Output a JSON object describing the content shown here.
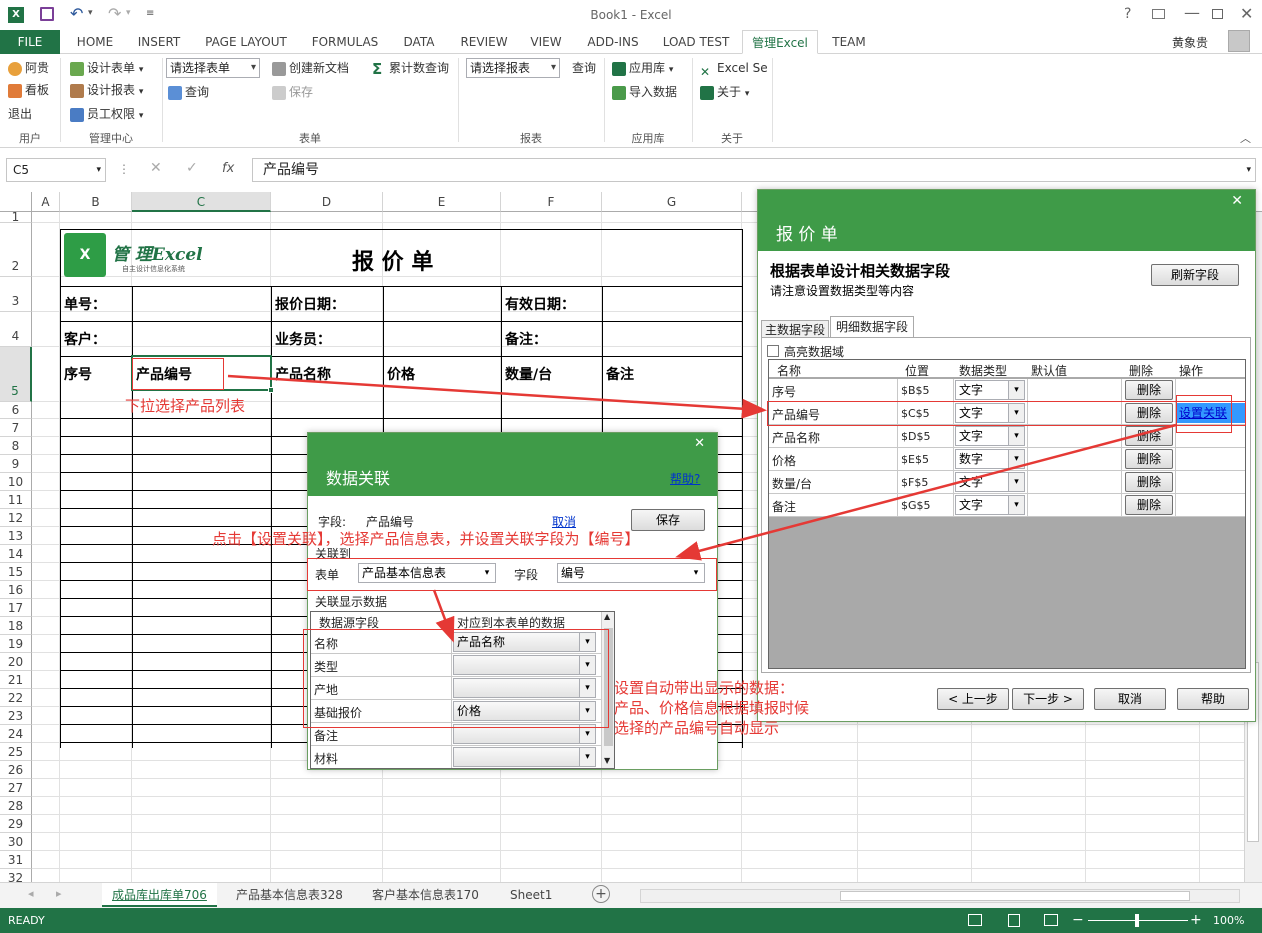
{
  "window": {
    "title": "Book1 - Excel",
    "user": "黄象贵"
  },
  "tabs": [
    "FILE",
    "HOME",
    "INSERT",
    "PAGE LAYOUT",
    "FORMULAS",
    "DATA",
    "REVIEW",
    "VIEW",
    "ADD-INS",
    "LOAD TEST",
    "管理Excel",
    "TEAM"
  ],
  "ribbon": {
    "user_group": {
      "label": "用户",
      "items": [
        "阿贵",
        "看板",
        "退出"
      ]
    },
    "mgmt_group": {
      "label": "管理中心",
      "items": [
        "设计表单",
        "设计报表",
        "员工权限"
      ]
    },
    "form_group": {
      "label": "表单",
      "select": "请选择表单",
      "query": "查询",
      "create": "创建新文档",
      "save": "保存"
    },
    "cum_query": "累计数查询",
    "report_group": {
      "label": "报表",
      "select": "请选择报表",
      "query": "查询"
    },
    "app_group": {
      "label": "应用库",
      "items": [
        "应用库",
        "导入数据"
      ]
    },
    "about_group": {
      "label": "关于",
      "items": [
        "Excel Se",
        "关于"
      ]
    }
  },
  "formula_bar": {
    "name_box": "C5",
    "fx": "fx",
    "formula": "产品编号"
  },
  "columns": [
    "A",
    "B",
    "C",
    "D",
    "E",
    "F",
    "G"
  ],
  "rows": [
    "1",
    "2",
    "3",
    "4",
    "5",
    "6",
    "7",
    "8",
    "9",
    "10",
    "11",
    "12",
    "13",
    "14",
    "15",
    "16",
    "17",
    "18",
    "19",
    "20",
    "21",
    "22",
    "23",
    "24",
    "25",
    "26",
    "27",
    "28",
    "29",
    "30",
    "31",
    "32"
  ],
  "sheet": {
    "logo_text": "管 理Excel",
    "logo_sub": "自主设计信息化系统",
    "title": "报 价 单",
    "r3": [
      "单号：",
      "报价日期：",
      "有效日期："
    ],
    "r4": [
      "客户：",
      "业务员：",
      "备注："
    ],
    "r5": [
      "序号",
      "产品编号",
      "产品名称",
      "价格",
      "数量/台",
      "备注"
    ]
  },
  "sheet_tabs": [
    "成品库出库单706",
    "产品基本信息表328",
    "客户基本信息表170",
    "Sheet1"
  ],
  "status": {
    "ready": "READY",
    "zoom": "100%"
  },
  "panel": {
    "title": "报 价 单",
    "heading": "根据表单设计相关数据字段",
    "subheading": "请注意设置数据类型等内容",
    "refresh": "刷新字段",
    "tabs": [
      "主数据字段",
      "明细数据字段"
    ],
    "highlight": "高亮数据域",
    "headers": [
      "名称",
      "位置",
      "数据类型",
      "默认值",
      "删除",
      "操作"
    ],
    "rows": [
      {
        "name": "序号",
        "pos": "$B$5",
        "type": "文字",
        "del": "删除",
        "op": ""
      },
      {
        "name": "产品编号",
        "pos": "$C$5",
        "type": "文字",
        "del": "删除",
        "op": "设置关联"
      },
      {
        "name": "产品名称",
        "pos": "$D$5",
        "type": "文字",
        "del": "删除",
        "op": ""
      },
      {
        "name": "价格",
        "pos": "$E$5",
        "type": "数字",
        "del": "删除",
        "op": ""
      },
      {
        "name": "数量/台",
        "pos": "$F$5",
        "type": "文字",
        "del": "删除",
        "op": ""
      },
      {
        "name": "备注",
        "pos": "$G$5",
        "type": "文字",
        "del": "删除",
        "op": ""
      }
    ],
    "buttons": [
      "< 上一步",
      "下一步 >",
      "取消",
      "帮助"
    ]
  },
  "dialog": {
    "title": "数据关联",
    "help": "帮助?",
    "field_label": "字段:",
    "field_value": "产品编号",
    "cancel": "取消",
    "save": "保存",
    "assoc_label": "关联到",
    "form_label": "表单",
    "form_value": "产品基本信息表",
    "field2_label": "字段",
    "field2_value": "编号",
    "display_label": "关联显示数据",
    "col1": "数据源字段",
    "col2": "对应到本表单的数据",
    "rows": [
      {
        "src": "名称",
        "dst": "产品名称"
      },
      {
        "src": "类型",
        "dst": ""
      },
      {
        "src": "产地",
        "dst": ""
      },
      {
        "src": "基础报价",
        "dst": "价格"
      },
      {
        "src": "备注",
        "dst": ""
      },
      {
        "src": "材料",
        "dst": ""
      }
    ]
  },
  "notes": {
    "n1": "下拉选择产品列表",
    "n2": "点击【设置关联】，选择产品信息表，并设置关联字段为【编号】",
    "n3": [
      "设置自动带出显示的数据：",
      "产品、价格信息根据填报时候",
      "选择的产品编号自动显示"
    ]
  }
}
